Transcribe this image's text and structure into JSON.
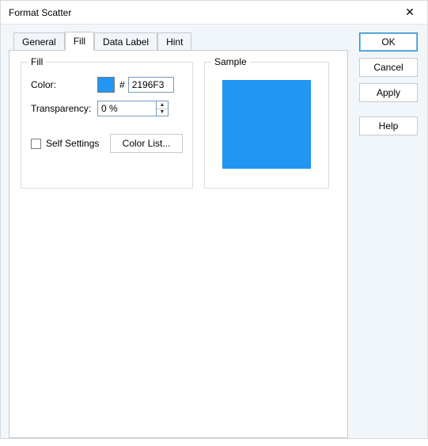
{
  "window": {
    "title": "Format Scatter"
  },
  "tabs": {
    "general": "General",
    "fill": "Fill",
    "data_label": "Data Label",
    "hint": "Hint",
    "active": "fill"
  },
  "fill_group": {
    "legend": "Fill",
    "color_label": "Color:",
    "hash": "#",
    "color_value": "2196F3",
    "swatch_color": "#2196F3",
    "transparency_label": "Transparency:",
    "transparency_value": "0 %",
    "self_settings_label": "Self Settings",
    "color_list_label": "Color List..."
  },
  "sample_group": {
    "legend": "Sample",
    "swatch_color": "#2196F3"
  },
  "buttons": {
    "ok": "OK",
    "cancel": "Cancel",
    "apply": "Apply",
    "help": "Help"
  }
}
